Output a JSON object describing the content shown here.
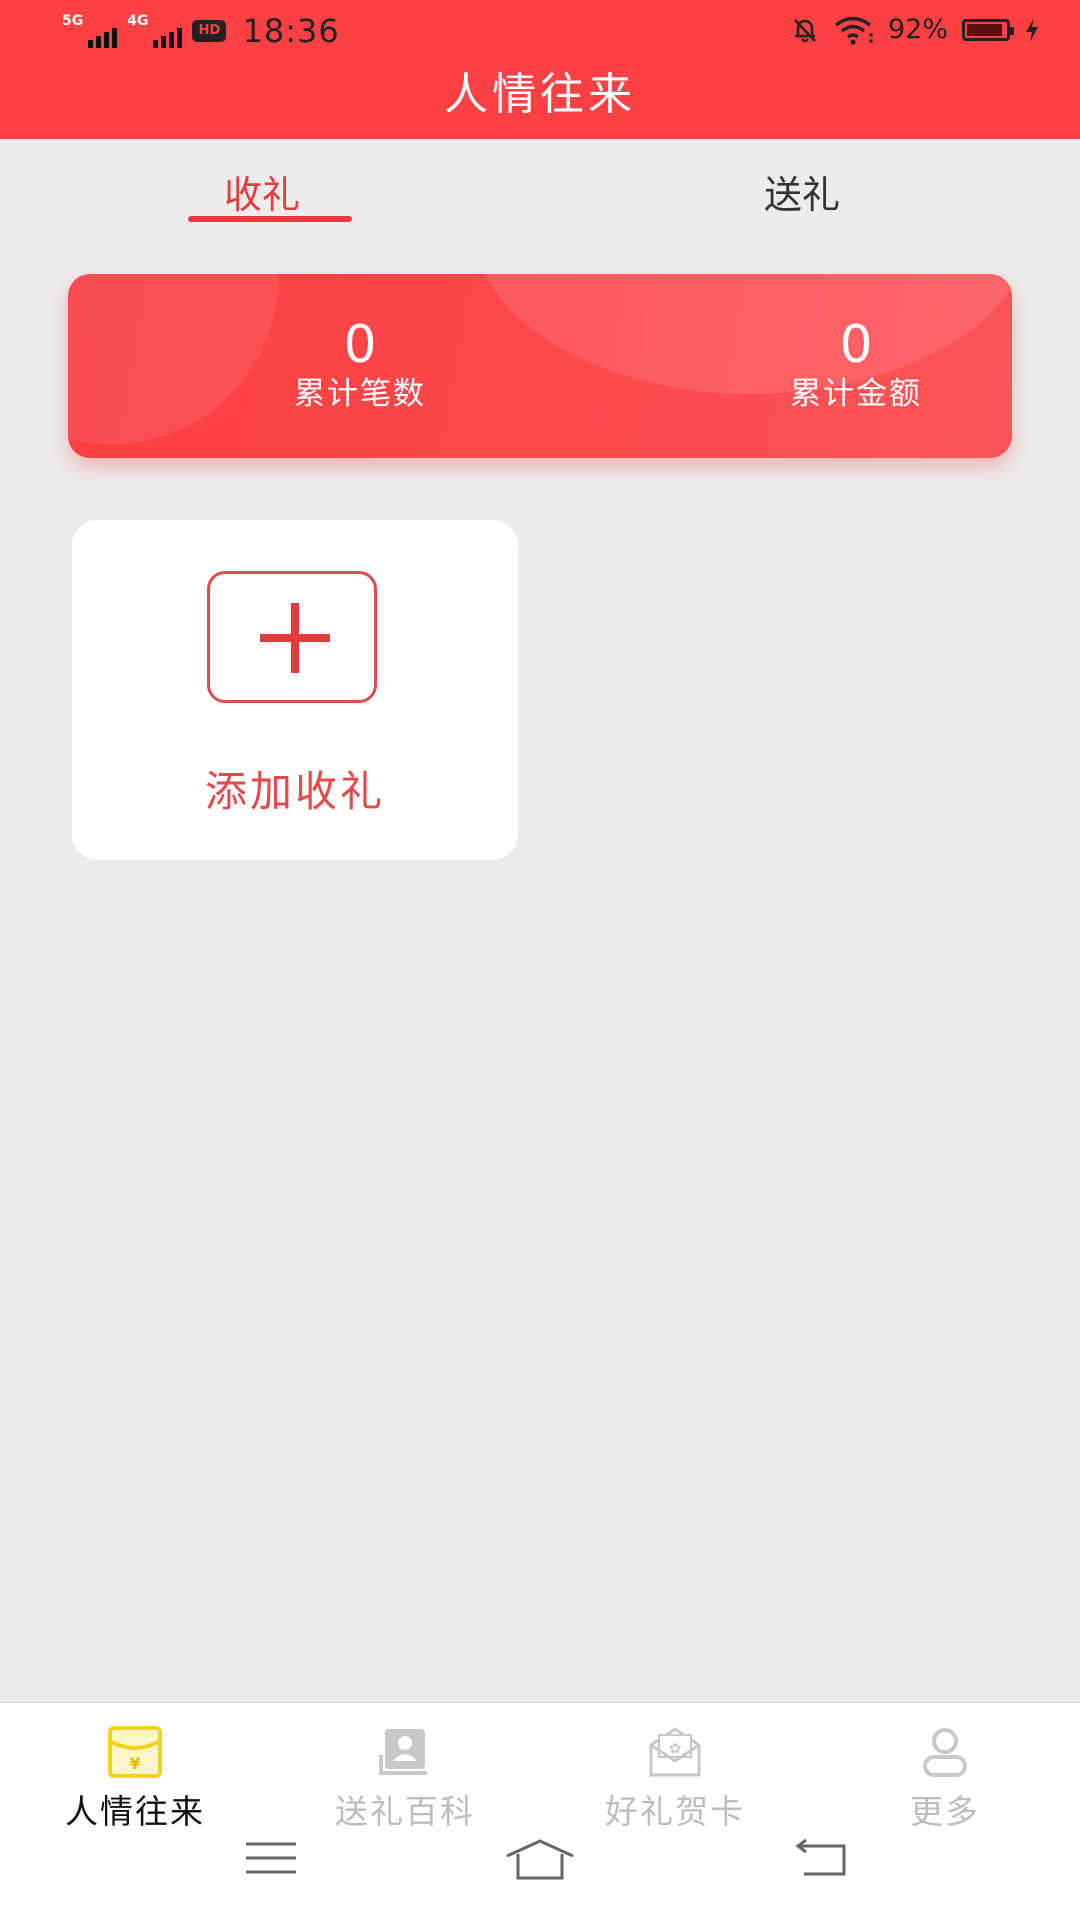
{
  "status_bar": {
    "network1": "5G",
    "network2": "4G",
    "hd_label": "HD",
    "time": "18:36",
    "battery": "92%",
    "battery_level": 0.92
  },
  "header": {
    "title": "人情往来"
  },
  "tabs": [
    {
      "label": "收礼",
      "active": true
    },
    {
      "label": "送礼",
      "active": false
    }
  ],
  "summary": {
    "count_value": "0",
    "count_label": "累计笔数",
    "amount_value": "0",
    "amount_label": "累计金额"
  },
  "add_card": {
    "label": "添加收礼"
  },
  "bottom_nav": [
    {
      "label": "人情往来",
      "icon": "red-envelope-icon",
      "active": true
    },
    {
      "label": "送礼百科",
      "icon": "encyclopedia-icon",
      "active": false
    },
    {
      "label": "好礼贺卡",
      "icon": "greeting-card-icon",
      "active": false
    },
    {
      "label": "更多",
      "icon": "user-icon",
      "active": false
    }
  ],
  "colors": {
    "brand_red": "#fd4044",
    "active_nav_icon": "#f2d21c",
    "inactive_text": "#bdbdbd"
  }
}
